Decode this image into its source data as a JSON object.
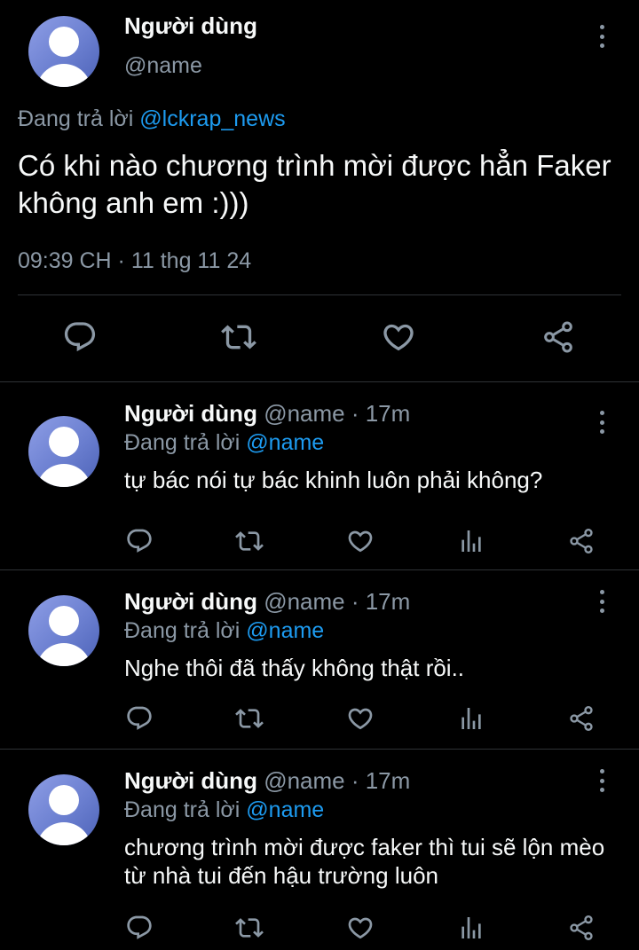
{
  "main_tweet": {
    "user_name": "Người dùng",
    "handle": "@name",
    "replying_prefix": "Đang trả lời",
    "replying_to": "@lckrap_news",
    "text": "Có khi nào chương trình mời được hẳn Faker không anh em :)))",
    "timestamp": "09:39 CH · 11 thg 11 24"
  },
  "replies": [
    {
      "user_name": "Người dùng",
      "meta": "@name · 17m",
      "replying_prefix": "Đang trả lời",
      "replying_to": "@name",
      "text": "tự bác nói tự bác khinh luôn phải không?"
    },
    {
      "user_name": "Người dùng",
      "meta": "@name · 17m",
      "replying_prefix": "Đang trả lời",
      "replying_to": "@name",
      "text": "Nghe thôi đã thấy không thật rồi.."
    },
    {
      "user_name": "Người dùng",
      "meta": "@name · 17m",
      "replying_prefix": "Đang trả lời",
      "replying_to": "@name",
      "text": "chương trình mời được faker thì tui sẽ lộn mèo từ nhà tui đến hậu trường luôn"
    }
  ],
  "icons": {
    "reply": "reply-icon",
    "retweet": "retweet-icon",
    "like": "heart-icon",
    "views": "views-icon",
    "share": "share-icon",
    "more": "more-vertical-icon"
  },
  "colors": {
    "background": "#000000",
    "text": "#f7f9f9",
    "secondary_text": "#8b98a5",
    "link": "#1d9bf0",
    "divider": "#2f3336"
  }
}
